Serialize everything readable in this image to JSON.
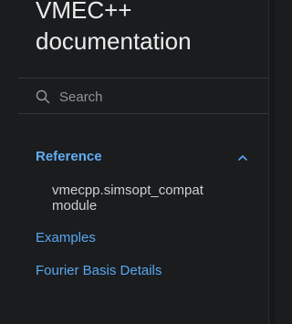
{
  "sidebar": {
    "brand_line1": "VMEC++",
    "brand_line2": "documentation",
    "search": {
      "placeholder": "Search",
      "value": ""
    },
    "nav": {
      "reference": {
        "label": "Reference",
        "expanded": true,
        "children": [
          {
            "line1": "vmecpp.simsopt_compat",
            "line2": "module"
          }
        ]
      },
      "examples": {
        "label": "Examples"
      },
      "fourier": {
        "label": "Fourier Basis Details"
      }
    }
  },
  "colors": {
    "background": "#1a1c1e",
    "link": "#5aa7f0",
    "text": "#d4d4d4",
    "divider": "#33363a"
  },
  "icons": {
    "search": "search-icon",
    "chevron": "chevron-up-icon"
  }
}
